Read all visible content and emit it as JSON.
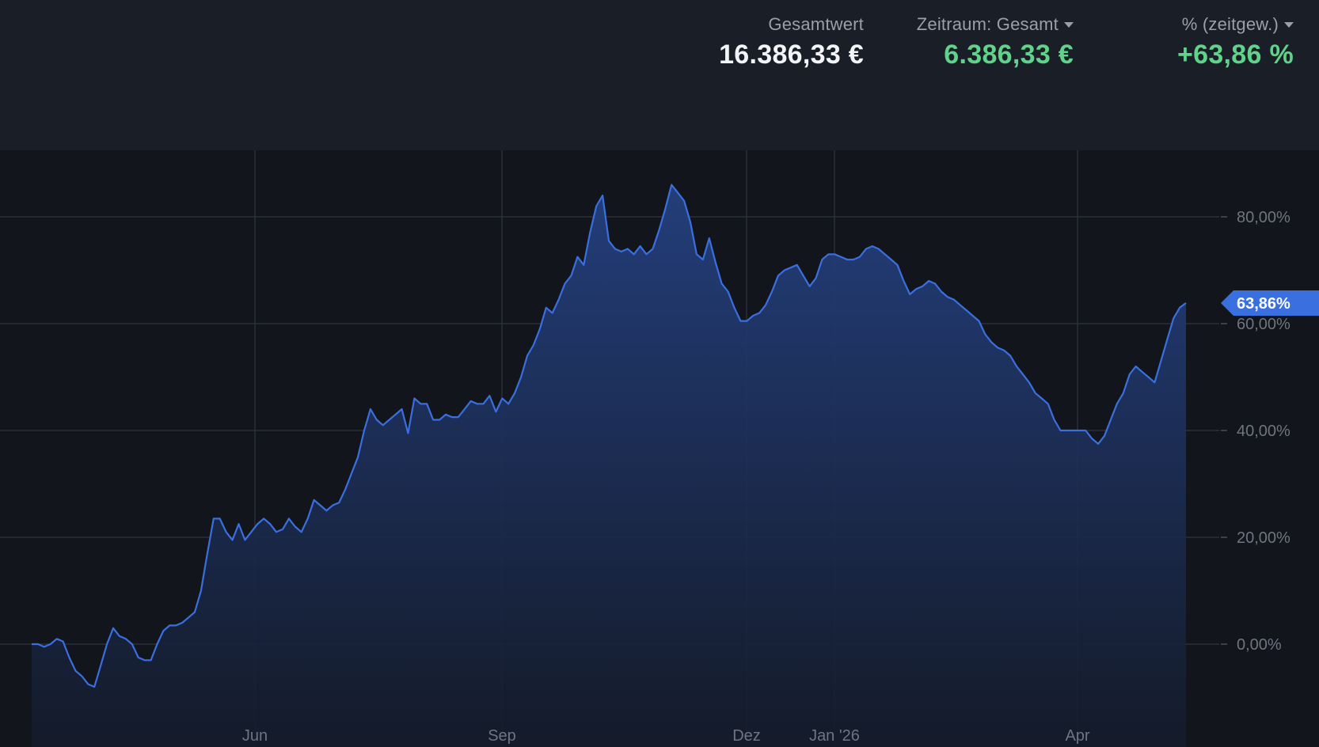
{
  "header": {
    "total": {
      "label": "Gesamtwert",
      "value": "16.386,33 €"
    },
    "period": {
      "label": "Zeitraum: Gesamt",
      "value": "6.386,33 €"
    },
    "percent": {
      "label": "% (zeitgew.)",
      "value": "+63,86 %"
    }
  },
  "colors": {
    "background": "#1a1e27",
    "chart_bg": "#12151b",
    "line": "#3a6fe0",
    "positive": "#5fd38a",
    "badge": "#3a6fe0"
  },
  "chart_data": {
    "type": "area",
    "title": "",
    "xlabel": "",
    "ylabel": "",
    "x_ticks": [
      "Jun",
      "Sep",
      "Dez",
      "Jan '26",
      "Apr"
    ],
    "y_ticks": [
      "0,00%",
      "20,00%",
      "40,00%",
      "60,00%",
      "80,00%"
    ],
    "y_tick_values": [
      0,
      20,
      40,
      60,
      80
    ],
    "ylim": [
      -15,
      90
    ],
    "grid": true,
    "current_value_label": "63,86%",
    "current_value": 63.86,
    "series": [
      {
        "values": [
          0.0,
          0.0,
          -0.5,
          0.0,
          1.0,
          0.5,
          -2.5,
          -5.0,
          -6.0,
          -7.5,
          -8.0,
          -4.0,
          0.0,
          3.0,
          1.5,
          1.0,
          0.0,
          -2.5,
          -3.0,
          -3.0,
          0.0,
          2.5,
          3.5,
          3.5,
          4.0,
          5.0,
          6.0,
          10.0,
          17.0,
          23.5,
          23.5,
          21.0,
          19.5,
          22.5,
          19.5,
          21.0,
          22.5,
          23.5,
          22.5,
          21.0,
          21.5,
          23.5,
          22.0,
          21.0,
          23.5,
          27.0,
          26.0,
          25.0,
          26.0,
          26.5,
          29.0,
          32.0,
          35.0,
          40.0,
          44.0,
          42.0,
          41.0,
          42.0,
          43.0,
          44.0,
          39.5,
          46.0,
          45.0,
          45.0,
          42.0,
          42.0,
          43.0,
          42.5,
          42.5,
          44.0,
          45.5,
          45.0,
          45.0,
          46.5,
          43.5,
          46.0,
          45.0,
          47.0,
          50.0,
          54.0,
          56.0,
          59.0,
          63.0,
          62.0,
          64.5,
          67.5,
          69.0,
          72.5,
          71.0,
          77.0,
          82.0,
          84.0,
          75.5,
          74.0,
          73.5,
          74.0,
          73.0,
          74.5,
          73.0,
          74.0,
          77.5,
          81.5,
          86.0,
          84.5,
          83.0,
          79.0,
          73.0,
          72.0,
          76.0,
          71.5,
          67.5,
          66.0,
          63.0,
          60.5,
          60.5,
          61.5,
          62.0,
          63.5,
          66.0,
          69.0,
          70.0,
          70.5,
          71.0,
          69.0,
          67.0,
          68.5,
          72.0,
          73.0,
          73.0,
          72.5,
          72.0,
          72.0,
          72.5,
          74.0,
          74.5,
          74.0,
          73.0,
          72.0,
          71.0,
          68.0,
          65.5,
          66.5,
          67.0,
          68.0,
          67.5,
          66.0,
          65.0,
          64.5,
          63.5,
          62.5,
          61.5,
          60.5,
          58.0,
          56.5,
          55.5,
          55.0,
          54.0,
          52.0,
          50.5,
          49.0,
          47.0,
          46.0,
          45.0,
          42.0,
          40.0,
          40.0,
          40.0,
          40.0,
          40.0,
          38.5,
          37.5,
          39.0,
          42.0,
          45.0,
          47.0,
          50.5,
          52.0,
          51.0,
          50.0,
          49.0,
          53.0,
          57.0,
          61.0,
          63.0,
          63.86
        ]
      }
    ]
  }
}
